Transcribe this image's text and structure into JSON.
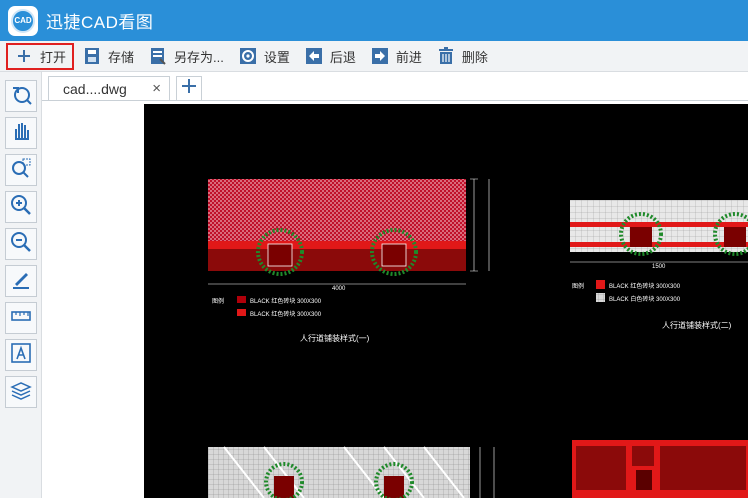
{
  "app": {
    "title": "迅捷CAD看图",
    "logo_text": "CAD"
  },
  "toolbar": {
    "open": "打开",
    "save": "存储",
    "save_as": "另存为...",
    "settings": "设置",
    "back": "后退",
    "forward": "前进",
    "delete": "删除"
  },
  "tabs": [
    {
      "label": "cad....dwg",
      "close": "×"
    }
  ],
  "left_tools": [
    "undo-view-icon",
    "pan-hand-icon",
    "zoom-window-icon",
    "zoom-in-icon",
    "zoom-out-icon",
    "markup-pen-icon",
    "measure-ruler-icon",
    "text-annotation-icon",
    "layers-icon"
  ],
  "drawing": {
    "legend_label": "图例",
    "legend_items_left": [
      "BLACK 红色砖块 300X300",
      "BLACK 红色砖块 300X300"
    ],
    "legend_items_right": [
      "BLACK 红色砖块 300X300",
      "BLACK 白色砖块 300X300"
    ],
    "caption_left": "人行道铺装样式(一)",
    "caption_right": "人行道铺装样式(二)",
    "dim_left": "4000",
    "dim_right": "1500"
  },
  "colors": {
    "titlebar": "#2a8fd8",
    "highlight": "#e02020",
    "cad_bg": "#000000",
    "brick_red": "#b0000a",
    "tree_green": "#1f8a2a"
  }
}
